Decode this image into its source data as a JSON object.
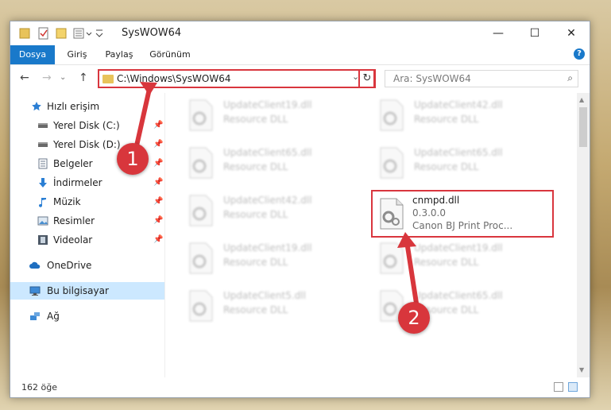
{
  "window": {
    "title": "SysWOW64",
    "controls": {
      "minimize": "—",
      "maximize": "☐",
      "close": "✕"
    }
  },
  "ribbon": {
    "tabs": [
      "Dosya",
      "Giriş",
      "Paylaş",
      "Görünüm"
    ],
    "help": "?"
  },
  "navigation": {
    "back": "←",
    "forward": "→",
    "history": "⌄",
    "up": "↑",
    "address": "C:\\Windows\\SysWOW64",
    "address_dropdown": "⌄",
    "refresh": "↻",
    "search_placeholder": "Ara: SysWOW64",
    "search_icon": "⌕"
  },
  "sidebar": {
    "items": [
      {
        "label": "Hızlı erişim",
        "icon": "star-icon",
        "pinned": false
      },
      {
        "label": "Yerel Disk (C:)",
        "icon": "drive-icon",
        "pinned": true
      },
      {
        "label": "Yerel Disk (D:)",
        "icon": "drive-icon",
        "pinned": true
      },
      {
        "label": "Belgeler",
        "icon": "documents-icon",
        "pinned": true
      },
      {
        "label": "İndirmeler",
        "icon": "downloads-icon",
        "pinned": true
      },
      {
        "label": "Müzik",
        "icon": "music-icon",
        "pinned": true
      },
      {
        "label": "Resimler",
        "icon": "pictures-icon",
        "pinned": true
      },
      {
        "label": "Videolar",
        "icon": "videos-icon",
        "pinned": true
      },
      {
        "label": "OneDrive",
        "icon": "cloud-icon",
        "pinned": false
      },
      {
        "label": "Bu bilgisayar",
        "icon": "computer-icon",
        "pinned": false,
        "selected": true
      },
      {
        "label": "Ağ",
        "icon": "network-icon",
        "pinned": false
      }
    ],
    "pin_glyph": "📌"
  },
  "files": [
    {
      "name": "UpdateClient19.dll",
      "desc": "Resource DLL",
      "blurred": true
    },
    {
      "name": "UpdateClient42.dll",
      "desc": "Resource DLL",
      "blurred": true
    },
    {
      "name": "UpdateClient65.dll",
      "desc": "Resource DLL",
      "blurred": true
    },
    {
      "name": "UpdateClient65.dll",
      "desc": "Resource DLL",
      "blurred": true
    },
    {
      "name": "UpdateClient42.dll",
      "desc": "Resource DLL",
      "blurred": true
    },
    {
      "name": "cnmpd.dll",
      "version": "0.3.0.0",
      "desc": "Canon BJ Print Proc...",
      "blurred": false
    },
    {
      "name": "UpdateClient19.dll",
      "desc": "Resource DLL",
      "blurred": true
    },
    {
      "name": "UpdateClient19.dll",
      "desc": "Resource DLL",
      "blurred": true
    },
    {
      "name": "UpdateClient5.dll",
      "desc": "Resource DLL",
      "blurred": true
    },
    {
      "name": "UpdateClient65.dll",
      "desc": "Resource DLL",
      "blurred": true
    }
  ],
  "status": {
    "item_count": "162 öğe"
  },
  "annotations": {
    "callout_1": "1",
    "callout_2": "2",
    "highlight_color": "#d9363e",
    "callout_color": "#d8363c"
  },
  "colors": {
    "accent": "#1979ca",
    "selected": "#cce8ff"
  }
}
